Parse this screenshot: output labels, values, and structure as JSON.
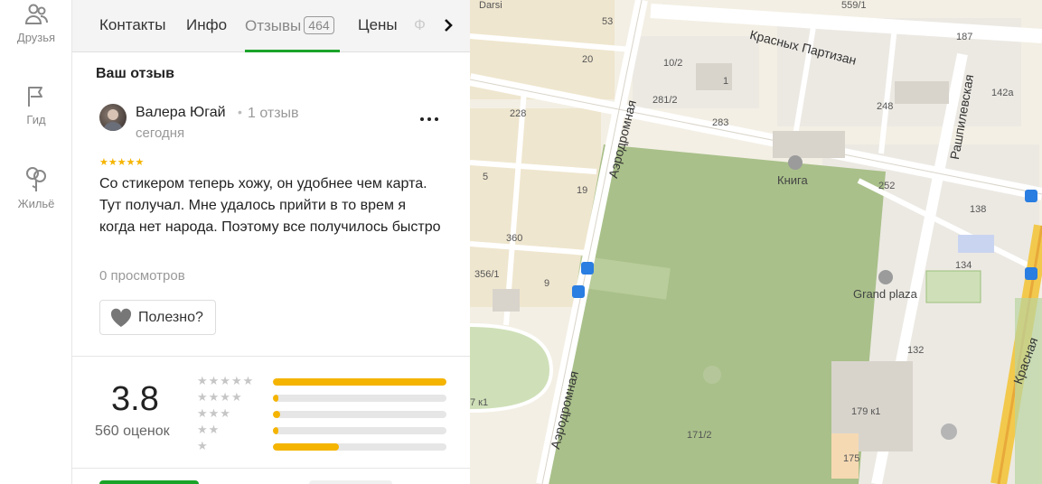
{
  "sidebar": {
    "items": [
      {
        "label": "Друзья",
        "icon": "friends-icon"
      },
      {
        "label": "Гид",
        "icon": "flag-icon"
      },
      {
        "label": "Жильё",
        "icon": "housing-icon"
      }
    ]
  },
  "tabs": {
    "contacts": "Контакты",
    "info": "Инфо",
    "reviews": "Отзывы",
    "reviews_count": "464",
    "prices": "Цены",
    "next_partial": "Ф"
  },
  "review_section": {
    "title": "Ваш отзыв",
    "author": "Валера Югай",
    "author_reviews": "1 отзыв",
    "date": "сегодня",
    "stars": "★★★★★",
    "rating": 5,
    "text": "Со стикером теперь хожу, он удобнее чем карта. Тут получал. Мне удалось прийти в то врем я когда нет народа. Поэтому все получилось быстро",
    "views": "0 просмотров",
    "useful_label": "Полезно?"
  },
  "rating_summary": {
    "score": "3.8",
    "count_label": "560 оценок",
    "distribution": [
      {
        "stars": "★★★★★",
        "fraction": 1.0
      },
      {
        "stars": "★★★★",
        "fraction": 0.03
      },
      {
        "stars": "★★★",
        "fraction": 0.04
      },
      {
        "stars": "★★",
        "fraction": 0.03
      },
      {
        "stars": "★",
        "fraction": 0.38
      }
    ]
  },
  "map": {
    "labels": {
      "darsi": "Darsi",
      "n53": "53",
      "n559": "559/1",
      "krasnyh": "Красных Партизан",
      "n20": "20",
      "n10_2": "10/2",
      "n1": "1",
      "n187": "187",
      "n281": "281/2",
      "n228": "228",
      "n283": "283",
      "n248": "248",
      "n142a": "142а",
      "rashpilevskaya": "Рашпилевская",
      "aerodromnaya1": "Аэродромная",
      "kniga": "Книга",
      "n252": "252",
      "n5": "5",
      "n19": "19",
      "n138": "138",
      "n360": "360",
      "n134": "134",
      "n356": "356/1",
      "n9": "9",
      "grandplaza": "Grand plaza",
      "n132": "132",
      "krasnaya": "Красная",
      "aerodromnaya2": "Аэродромная",
      "n7k1": "7 к1",
      "n179": "179 к1",
      "n171": "171/2",
      "n175": "175"
    }
  },
  "colors": {
    "accent_green": "#1aa329",
    "star_yellow": "#f5b400",
    "map_park": "#a9c08a",
    "map_bg": "#f3efe4"
  }
}
